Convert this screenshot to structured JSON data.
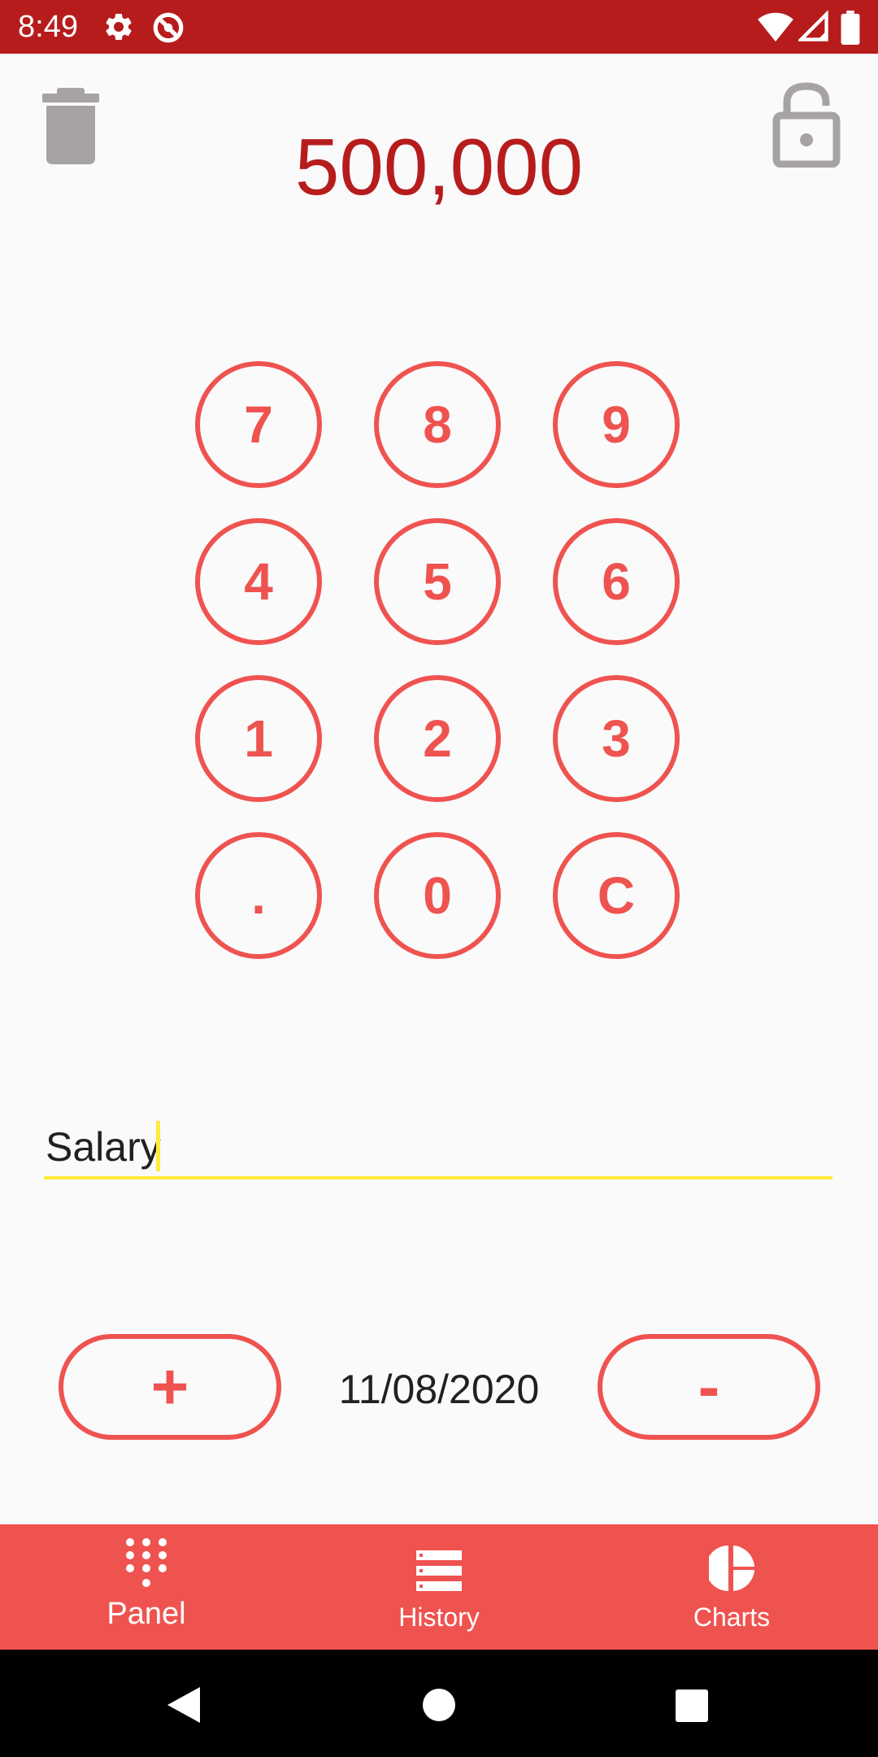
{
  "status_bar": {
    "time": "8:49",
    "background": "#b71c1c",
    "icons": [
      "gear-icon",
      "no-sync-icon",
      "wifi-icon",
      "signal-icon",
      "battery-icon"
    ]
  },
  "header": {
    "amount": "500,000",
    "amount_color": "#b71c1c",
    "left_icon": "trash-icon",
    "right_icon": "unlocked-padlock-icon"
  },
  "keypad": {
    "accent": "#ef5350",
    "keys": [
      "7",
      "8",
      "9",
      "4",
      "5",
      "6",
      "1",
      "2",
      "3",
      ".",
      "0",
      "C"
    ]
  },
  "description": {
    "value": "Salary",
    "underline_color": "#ffeb3b"
  },
  "actions": {
    "add_label": "+",
    "date": "11/08/2020",
    "subtract_label": "-"
  },
  "bottom_nav": {
    "background": "#ef5350",
    "items": [
      {
        "label": "Panel",
        "icon": "dialpad-icon",
        "active": true
      },
      {
        "label": "History",
        "icon": "list-icon",
        "active": false
      },
      {
        "label": "Charts",
        "icon": "pie-chart-icon",
        "active": false
      }
    ]
  },
  "system_nav": {
    "icons": [
      "back-icon",
      "home-icon",
      "recents-icon"
    ]
  }
}
